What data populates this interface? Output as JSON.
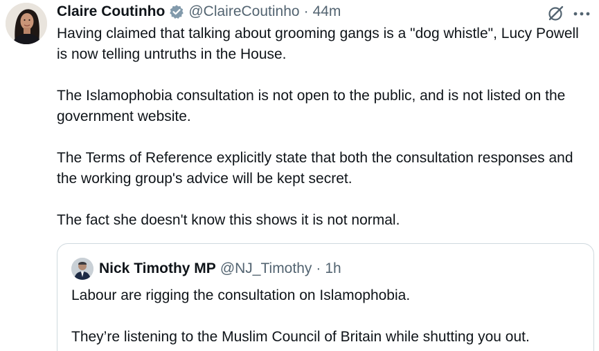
{
  "tweet": {
    "display_name": "Claire Coutinho",
    "handle": "@ClaireCoutinho",
    "separator": "·",
    "timestamp": "44m",
    "verified": true,
    "paragraphs": [
      "Having claimed that talking about grooming gangs is a \"dog whistle\", Lucy Powell is now telling untruths in the House.",
      "The Islamophobia consultation is not open to the public, and is not listed on the government website.",
      "The Terms of Reference explicitly state that both the consultation responses and the working group's advice will be kept secret.",
      "The fact she doesn't know this shows it is not normal."
    ],
    "icons": {
      "verified": "verified-badge-icon",
      "grok": "grok-icon",
      "more": "more-options-icon"
    }
  },
  "quoted_tweet": {
    "display_name": "Nick Timothy MP",
    "handle": "@NJ_Timothy",
    "separator": "·",
    "timestamp": "1h",
    "paragraphs": [
      "Labour are rigging the consultation on Islamophobia.",
      "They’re listening to the Muslim Council of Britain while shutting you out."
    ]
  },
  "colors": {
    "text": "#0f1419",
    "secondary_text": "#536471",
    "border": "#cfd9de",
    "verified_badge": "#829aab"
  }
}
